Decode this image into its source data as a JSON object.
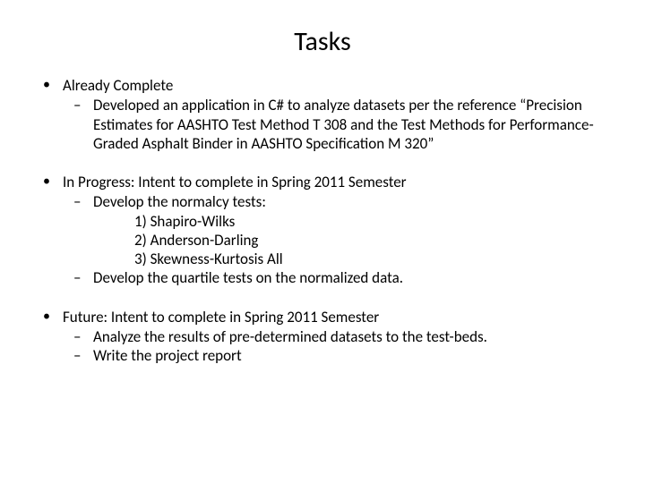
{
  "title": "Tasks",
  "sections": [
    {
      "heading": "Already Complete",
      "items": [
        {
          "text": "Developed an application in C# to analyze datasets per the reference “Precision Estimates for AASHTO Test Method T 308 and the Test Methods for Performance-Graded Asphalt Binder in AASHTO Specification M 320”"
        }
      ]
    },
    {
      "heading": "In Progress: Intent to complete in Spring 2011 Semester",
      "items": [
        {
          "text": "Develop the normalcy tests:",
          "numbered": [
            "1) Shapiro-Wilks",
            "2) Anderson-Darling",
            "3) Skewness-Kurtosis All"
          ]
        },
        {
          "text": "Develop the quartile tests on the normalized data.",
          "gap": true
        }
      ]
    },
    {
      "heading": "Future: Intent to complete in Spring 2011 Semester",
      "items": [
        {
          "text": "Analyze the results  of pre-determined datasets to the test-beds."
        },
        {
          "text": "Write the project report"
        }
      ]
    }
  ]
}
